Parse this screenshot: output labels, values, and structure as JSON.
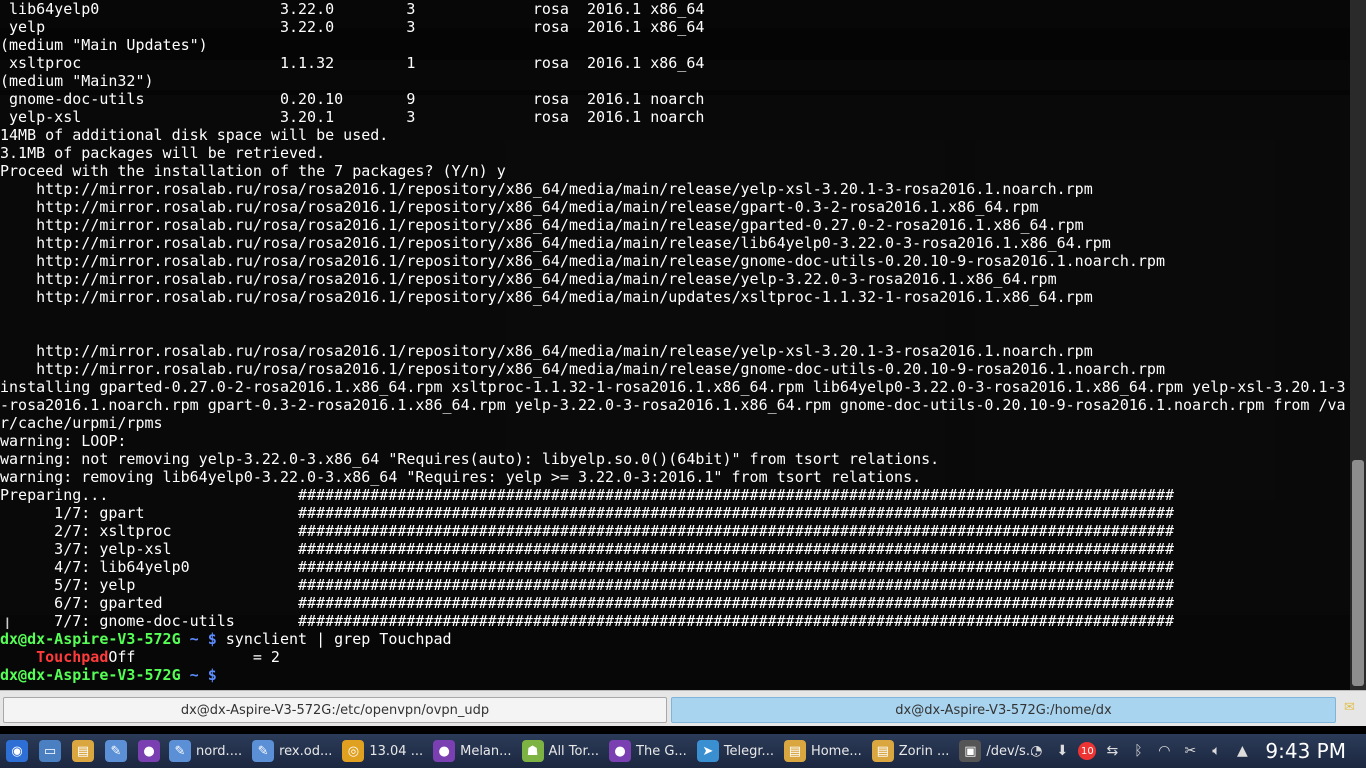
{
  "terminal": {
    "lines": [
      [
        {
          "t": " lib64yelp0                    3.22.0        3             rosa  2016.1 x86_64"
        }
      ],
      [
        {
          "t": " yelp                          3.22.0        3             rosa  2016.1 x86_64"
        }
      ],
      [
        {
          "t": "(medium \"Main Updates\")"
        }
      ],
      [
        {
          "t": " xsltproc                      1.1.32        1             rosa  2016.1 x86_64"
        }
      ],
      [
        {
          "t": "(medium \"Main32\")"
        }
      ],
      [
        {
          "t": " gnome-doc-utils               0.20.10       9             rosa  2016.1 noarch"
        }
      ],
      [
        {
          "t": " yelp-xsl                      3.20.1        3             rosa  2016.1 noarch"
        }
      ],
      [
        {
          "t": "14MB of additional disk space will be used."
        }
      ],
      [
        {
          "t": "3.1MB of packages will be retrieved."
        }
      ],
      [
        {
          "t": "Proceed with the installation of the 7 packages? (Y/n) y"
        }
      ],
      [
        {
          "t": "    http://mirror.rosalab.ru/rosa/rosa2016.1/repository/x86_64/media/main/release/yelp-xsl-3.20.1-3-rosa2016.1.noarch.rpm"
        }
      ],
      [
        {
          "t": "    http://mirror.rosalab.ru/rosa/rosa2016.1/repository/x86_64/media/main/release/gpart-0.3-2-rosa2016.1.x86_64.rpm"
        }
      ],
      [
        {
          "t": "    http://mirror.rosalab.ru/rosa/rosa2016.1/repository/x86_64/media/main/release/gparted-0.27.0-2-rosa2016.1.x86_64.rpm"
        }
      ],
      [
        {
          "t": "    http://mirror.rosalab.ru/rosa/rosa2016.1/repository/x86_64/media/main/release/lib64yelp0-3.22.0-3-rosa2016.1.x86_64.rpm"
        }
      ],
      [
        {
          "t": "    http://mirror.rosalab.ru/rosa/rosa2016.1/repository/x86_64/media/main/release/gnome-doc-utils-0.20.10-9-rosa2016.1.noarch.rpm"
        }
      ],
      [
        {
          "t": "    http://mirror.rosalab.ru/rosa/rosa2016.1/repository/x86_64/media/main/release/yelp-3.22.0-3-rosa2016.1.x86_64.rpm"
        }
      ],
      [
        {
          "t": "    http://mirror.rosalab.ru/rosa/rosa2016.1/repository/x86_64/media/main/updates/xsltproc-1.1.32-1-rosa2016.1.x86_64.rpm"
        }
      ],
      [
        {
          "t": ""
        }
      ],
      [
        {
          "t": ""
        }
      ],
      [
        {
          "t": "    http://mirror.rosalab.ru/rosa/rosa2016.1/repository/x86_64/media/main/release/yelp-xsl-3.20.1-3-rosa2016.1.noarch.rpm"
        }
      ],
      [
        {
          "t": "    http://mirror.rosalab.ru/rosa/rosa2016.1/repository/x86_64/media/main/release/gnome-doc-utils-0.20.10-9-rosa2016.1.noarch.rpm"
        }
      ],
      [
        {
          "t": "installing gparted-0.27.0-2-rosa2016.1.x86_64.rpm xsltproc-1.1.32-1-rosa2016.1.x86_64.rpm lib64yelp0-3.22.0-3-rosa2016.1.x86_64.rpm yelp-xsl-3.20.1-3"
        }
      ],
      [
        {
          "t": "-rosa2016.1.noarch.rpm gpart-0.3-2-rosa2016.1.x86_64.rpm yelp-3.22.0-3-rosa2016.1.x86_64.rpm gnome-doc-utils-0.20.10-9-rosa2016.1.noarch.rpm from /va"
        }
      ],
      [
        {
          "t": "r/cache/urpmi/rpms"
        }
      ],
      [
        {
          "t": "warning: LOOP:"
        }
      ],
      [
        {
          "t": "warning: not removing yelp-3.22.0-3.x86_64 \"Requires(auto): libyelp.so.0()(64bit)\" from tsort relations."
        }
      ],
      [
        {
          "t": "warning: removing lib64yelp0-3.22.0-3.x86_64 \"Requires: yelp >= 3.22.0-3:2016.1\" from tsort relations."
        }
      ],
      [
        {
          "t": "Preparing...                     #################################################################################################"
        }
      ],
      [
        {
          "t": "      1/7: gpart                 #################################################################################################"
        }
      ],
      [
        {
          "t": "      2/7: xsltproc              #################################################################################################"
        }
      ],
      [
        {
          "t": "      3/7: yelp-xsl              #################################################################################################"
        }
      ],
      [
        {
          "t": "      4/7: lib64yelp0            #################################################################################################"
        }
      ],
      [
        {
          "t": "      5/7: yelp                  #################################################################################################"
        }
      ],
      [
        {
          "t": "      6/7: gparted               #################################################################################################"
        }
      ],
      [
        {
          "t": "      7/7: gnome-doc-utils       #################################################################################################"
        }
      ],
      [
        {
          "t": "dx@dx-Aspire-V3-572G",
          "c": "prompt-user"
        },
        {
          "t": " ~ $",
          "c": "prompt-path"
        },
        {
          "t": " synclient | grep Touchpad"
        }
      ],
      [
        {
          "t": "    "
        },
        {
          "t": "Touchpad",
          "c": "match"
        },
        {
          "t": "Off             = 2"
        }
      ],
      [
        {
          "t": "dx@dx-Aspire-V3-572G",
          "c": "prompt-user"
        },
        {
          "t": " ~ $",
          "c": "prompt-path"
        },
        {
          "t": " "
        }
      ]
    ]
  },
  "tabs": [
    {
      "label": "dx@dx-Aspire-V3-572G:/etc/openvpn/ovpn_udp",
      "active": false
    },
    {
      "label": "dx@dx-Aspire-V3-572G:/home/dx",
      "active": true
    }
  ],
  "taskbar": {
    "launchers": [
      {
        "icon": "start-menu-icon",
        "color": "#2e6fd6",
        "glyph": "◉"
      },
      {
        "icon": "show-desktop-icon",
        "color": "#4a7fc1",
        "glyph": "▭"
      },
      {
        "icon": "file-manager-icon",
        "color": "#d9a640",
        "glyph": "▤"
      },
      {
        "icon": "text-editor-icon",
        "color": "#5b8fd6",
        "glyph": "✎"
      },
      {
        "icon": "tor-browser-icon",
        "color": "#7a3fb0",
        "glyph": "●"
      }
    ],
    "windows": [
      {
        "icon": "text-editor-icon",
        "color": "#5b8fd6",
        "glyph": "✎",
        "label": "nord...."
      },
      {
        "icon": "text-editor-icon",
        "color": "#5b8fd6",
        "glyph": "✎",
        "label": "rex.od..."
      },
      {
        "icon": "chrome-icon",
        "color": "#e0a020",
        "glyph": "◎",
        "label": "13.04 ..."
      },
      {
        "icon": "tor-browser-icon",
        "color": "#7a3fb0",
        "glyph": "●",
        "label": "Melan..."
      },
      {
        "icon": "android-icon",
        "color": "#7cb342",
        "glyph": "☗",
        "label": "All Tor..."
      },
      {
        "icon": "tor-browser-icon",
        "color": "#7a3fb0",
        "glyph": "●",
        "label": "The G..."
      },
      {
        "icon": "telegram-icon",
        "color": "#3a8fd0",
        "glyph": "➤",
        "label": "Telegr..."
      },
      {
        "icon": "folder-icon",
        "color": "#d9a640",
        "glyph": "▤",
        "label": "Home..."
      },
      {
        "icon": "folder-icon",
        "color": "#d9a640",
        "glyph": "▤",
        "label": "Zorin ..."
      },
      {
        "icon": "terminal-icon",
        "color": "#555555",
        "glyph": "▣",
        "label": "/dev/s..."
      }
    ],
    "tray": {
      "badge_count": "10",
      "clock": "9:43 PM"
    }
  }
}
